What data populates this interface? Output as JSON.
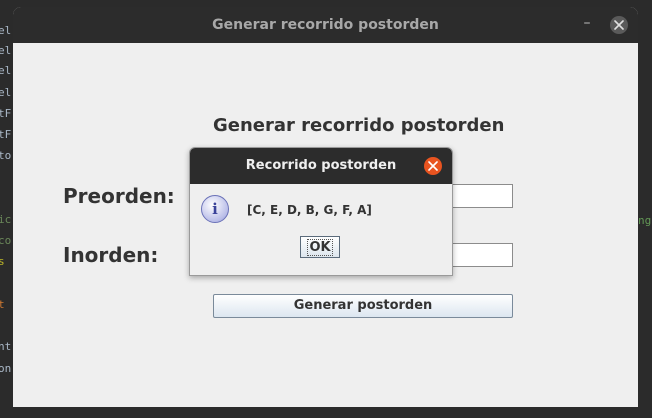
{
  "background": {
    "left_lines": [
      "el",
      "el",
      "el",
      "el",
      "tF",
      "tF",
      "to",
      "",
      "ic",
      "co",
      "s",
      "",
      "t",
      "",
      "nt",
      "on"
    ],
    "right_lines": [
      "ng"
    ]
  },
  "window": {
    "title": "Generar recorrido postorden",
    "minimize_symbol": "–",
    "heading": "Generar recorrido postorden",
    "preorden_label": "Preorden:",
    "inorden_label": "Inorden:",
    "preorden_value": "",
    "inorden_value": "",
    "generate_button": "Generar postorden"
  },
  "dialog": {
    "title": "Recorrido postorden",
    "info_glyph": "i",
    "message": "[C, E, D, B, G, F, A]",
    "ok_label": "OK"
  },
  "colors": {
    "titlebar": "#2c2c2c",
    "window_bg": "#efefef",
    "close_accent": "#e95420"
  }
}
